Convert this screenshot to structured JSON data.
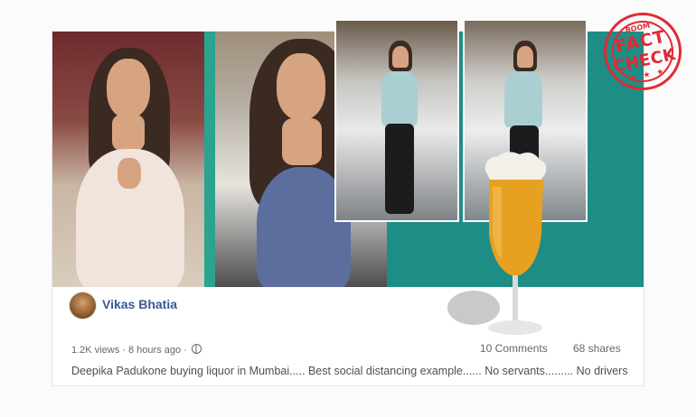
{
  "post": {
    "author": "Vikas Bhatia",
    "views": "1.2K views",
    "separator": "·",
    "time": "8 hours ago",
    "separator2": "·",
    "comments": "10 Comments",
    "shares": "68 shares",
    "caption": "Deepika Padukone buying liquor in Mumbai..... Best social distancing example...... No servants......... No drivers"
  },
  "stamp": {
    "brand": "BOOM",
    "line1": "FACT",
    "line2": "CHECK",
    "stars": "★ ★ ★"
  },
  "colors": {
    "author_link": "#385898",
    "stamp_red": "#e12a34",
    "teal_panel": "#1e8d86",
    "meta_gray": "#65676b"
  },
  "icons": [
    "globe-icon",
    "beer-glass-icon",
    "comment-bubble-icon"
  ]
}
